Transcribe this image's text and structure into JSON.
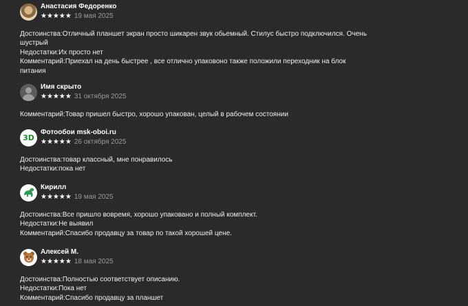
{
  "reviews": [
    {
      "author": "Анастасия Федоренко",
      "stars": "★★★★★",
      "date": "19 мая 2025",
      "avatar_icon": "user-photo",
      "lines": [
        "Достоинства:Отличный планшет экран просто шикарен звук обьемный. Стилус быстро подключился. Очень",
        "шустрый",
        "Недостатки:Их просто нет",
        "Комментарий:Приехал на день быстрее , все отлично упаковоно также положили переходник на блок",
        "питания"
      ]
    },
    {
      "author": "Имя скрыто",
      "stars": "★★★★★",
      "date": "31 октября 2025",
      "avatar_icon": "anonymous-user",
      "lines": [
        "Комментарий:Товар пришел быстро, хорошо упакован, целый в рабочем состоянии"
      ]
    },
    {
      "author": "Фотообои msk-oboi.ru",
      "stars": "★★★★★",
      "date": "26 октября 2025",
      "avatar_icon": "3d-logo",
      "avatar_text": "3D",
      "lines": [
        "Достоинства:товар классный, мне понравилось",
        "Недостатки:пока нет"
      ]
    },
    {
      "author": "Кирилл",
      "stars": "★★★★★",
      "date": "19 мая 2025",
      "avatar_icon": "dinosaur",
      "lines": [
        "Достоинства:Все пришло вовремя, хорошо упаковано и полный комплект.",
        "Недостатки:Не выявил",
        "Комментарий:Спасибо продавцу за товар по такой хорошей цене."
      ]
    },
    {
      "author": "Алексей М.",
      "stars": "★★★★★",
      "date": "18 мая 2025",
      "avatar_icon": "bear",
      "lines": [
        "Достоинства:Полностью соответствует описанию.",
        "Недостатки:Пока нет",
        "Комментарий:Спасибо продавцу за планшет"
      ]
    }
  ]
}
